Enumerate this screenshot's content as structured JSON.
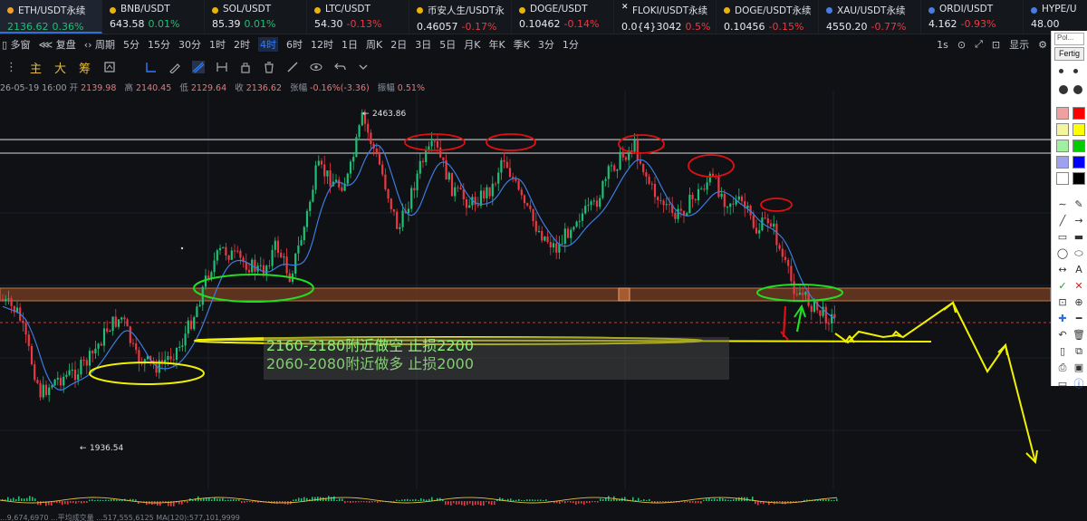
{
  "tickers": [
    {
      "name": "ETH/USDT永续",
      "price": "2136.62",
      "change": "0.36%",
      "dir": "up",
      "dot": "#f0a030",
      "active": true
    },
    {
      "name": "BNB/USDT",
      "price": "643.58",
      "change": "0.01%",
      "dir": "up",
      "dot": "#e8b40c"
    },
    {
      "name": "SOL/USDT",
      "price": "85.39",
      "change": "0.01%",
      "dir": "up",
      "dot": "#e8b40c"
    },
    {
      "name": "LTC/USDT",
      "price": "54.30",
      "change": "-0.13%",
      "dir": "dn",
      "dot": "#e8b40c"
    },
    {
      "name": "币安人生/USDT永",
      "price": "0.46057",
      "change": "-0.17%",
      "dir": "dn",
      "dot": "#e8b40c"
    },
    {
      "name": "DOGE/USDT",
      "price": "0.10462",
      "change": "-0.14%",
      "dir": "dn",
      "dot": "#e8b40c"
    },
    {
      "name": "FLOKI/USDT永续",
      "price": "0.0{4}3042",
      "change": "0.5%",
      "dir": "dn",
      "dot": "#ffffff",
      "dotglyph": "✕"
    },
    {
      "name": "DOGE/USDT永续",
      "price": "0.10456",
      "change": "-0.15%",
      "dir": "dn",
      "dot": "#e8b40c"
    },
    {
      "name": "XAU/USDT永续",
      "price": "4550.20",
      "change": "-0.77%",
      "dir": "dn",
      "dot": "#4a7de0"
    },
    {
      "name": "ORDI/USDT",
      "price": "4.162",
      "change": "-0.93%",
      "dir": "dn",
      "dot": "#4a7de0"
    },
    {
      "name": "HYPE/U",
      "price": "48.00",
      "change": "",
      "dir": "up",
      "dot": "#4a7de0"
    }
  ],
  "period_bar": {
    "items": [
      "▯ 多窗",
      "⋘ 复盘",
      "‹› 周期",
      "5分",
      "15分",
      "30分",
      "1时",
      "2时",
      "4时",
      "6时",
      "12时",
      "1日",
      "周K",
      "2日",
      "3日",
      "5日",
      "月K",
      "年K",
      "季K",
      "3分",
      "1分"
    ],
    "selected": "4时",
    "right": [
      "1s",
      "⊙",
      "⤢",
      "⊡",
      "显示",
      "⚙"
    ]
  },
  "draw_bar": {
    "labels": [
      "⋮",
      "主",
      "大",
      "筹"
    ]
  },
  "ohlc": {
    "time": "26-05-19 16:00",
    "open_label": "开",
    "open": "2139.98",
    "high_label": "高",
    "high": "2140.45",
    "low_label": "低",
    "low": "2129.64",
    "close_label": "收",
    "close": "2136.62",
    "change_label": "张幅",
    "change": "-0.16%(-3.36)",
    "amp_label": "振幅",
    "amp": "0.51%"
  },
  "chart": {
    "high_label": "2463.86",
    "low_label": "1936.54",
    "notes": [
      "2160-2180附近做空 止损2200",
      "2060-2080附近做多 止损2000"
    ]
  },
  "bottom": {
    "text": "...9,674,6970  ...平均成交量  ...517,555,6125   MA(120):577,101,9999"
  },
  "right_panel": {
    "title": "Pol...",
    "button": "Fertig",
    "tools": [
      "pointer-icon",
      "pen-icon",
      "line-icon",
      "rect-icon",
      "circle-icon",
      "arrow-icon",
      "text-icon",
      "check-icon",
      "close-icon",
      "zoom-icon",
      "undo-icon",
      "delete-icon",
      "save-icon",
      "print-icon",
      "info-icon"
    ],
    "colors": [
      "#f0a0a0",
      "#ff0000",
      "#f5f5a0",
      "#ffff00",
      "#a0f0a0",
      "#00cc00",
      "#a0a0f0",
      "#0000ff",
      "#ffffff",
      "#000000"
    ]
  },
  "colors": {
    "up": "#1fbf75",
    "down": "#ea3943",
    "accent": "#2f7bff",
    "annotation_yellow": "#f0f000",
    "annotation_red": "#e01010",
    "annotation_green": "#22dd22"
  }
}
